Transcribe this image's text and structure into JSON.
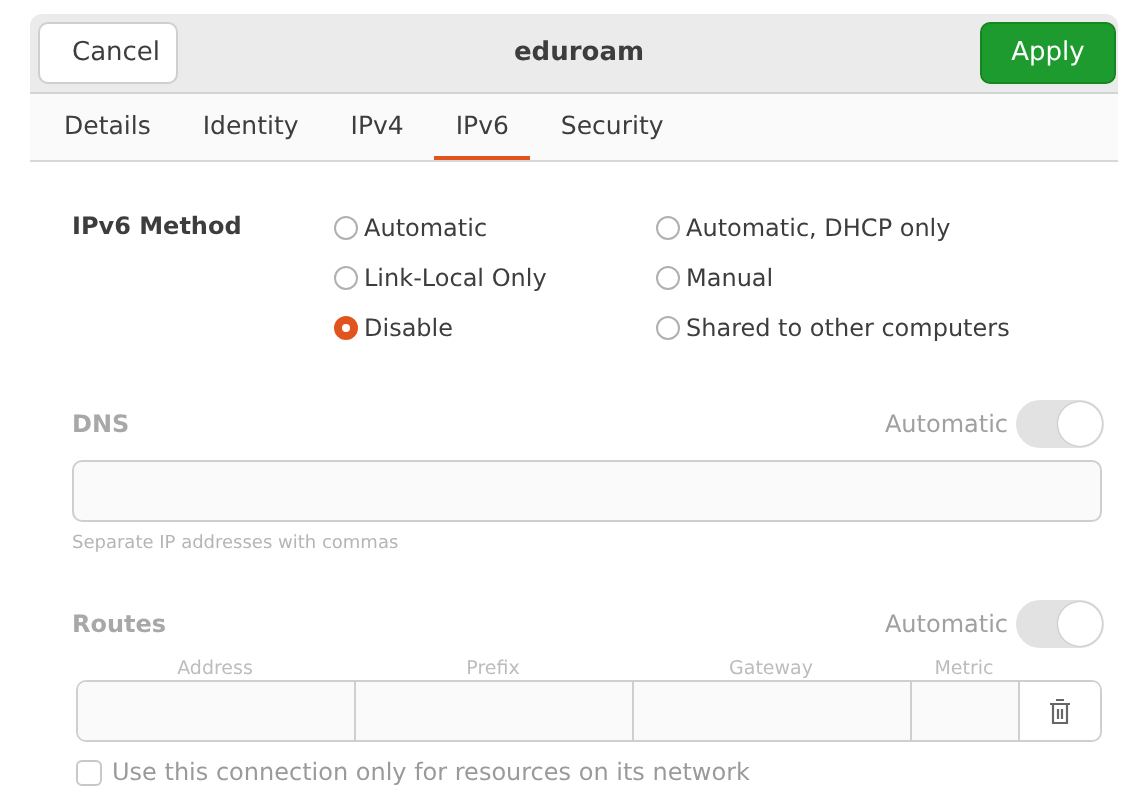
{
  "window": {
    "title": "eduroam"
  },
  "header_buttons": [
    {
      "label": "Cancel",
      "kind": "plain"
    },
    {
      "label": "Apply",
      "kind": "suggested"
    }
  ],
  "tabs": [
    {
      "label": "Details",
      "selected": false
    },
    {
      "label": "Identity",
      "selected": false
    },
    {
      "label": "IPv4",
      "selected": false
    },
    {
      "label": "IPv6",
      "selected": true
    },
    {
      "label": "Security",
      "selected": false
    }
  ],
  "method": {
    "label": "IPv6 Method",
    "options": [
      {
        "label": "Automatic",
        "selected": false
      },
      {
        "label": "Automatic, DHCP only",
        "selected": false
      },
      {
        "label": "Link-Local Only",
        "selected": false
      },
      {
        "label": "Manual",
        "selected": false
      },
      {
        "label": "Disable",
        "selected": true
      },
      {
        "label": "Shared to other computers",
        "selected": false
      }
    ]
  },
  "dns": {
    "label": "DNS",
    "disabled": true,
    "automatic_label": "Automatic",
    "automatic_on": true,
    "hint": "Separate IP addresses with commas"
  },
  "routes": {
    "label": "Routes",
    "disabled": true,
    "automatic_label": "Automatic",
    "automatic_on": true,
    "columns": [
      "Address",
      "Prefix",
      "Gateway",
      "Metric"
    ]
  },
  "only_local": {
    "label": "Use this connection only for resources on its network",
    "checked": false
  }
}
